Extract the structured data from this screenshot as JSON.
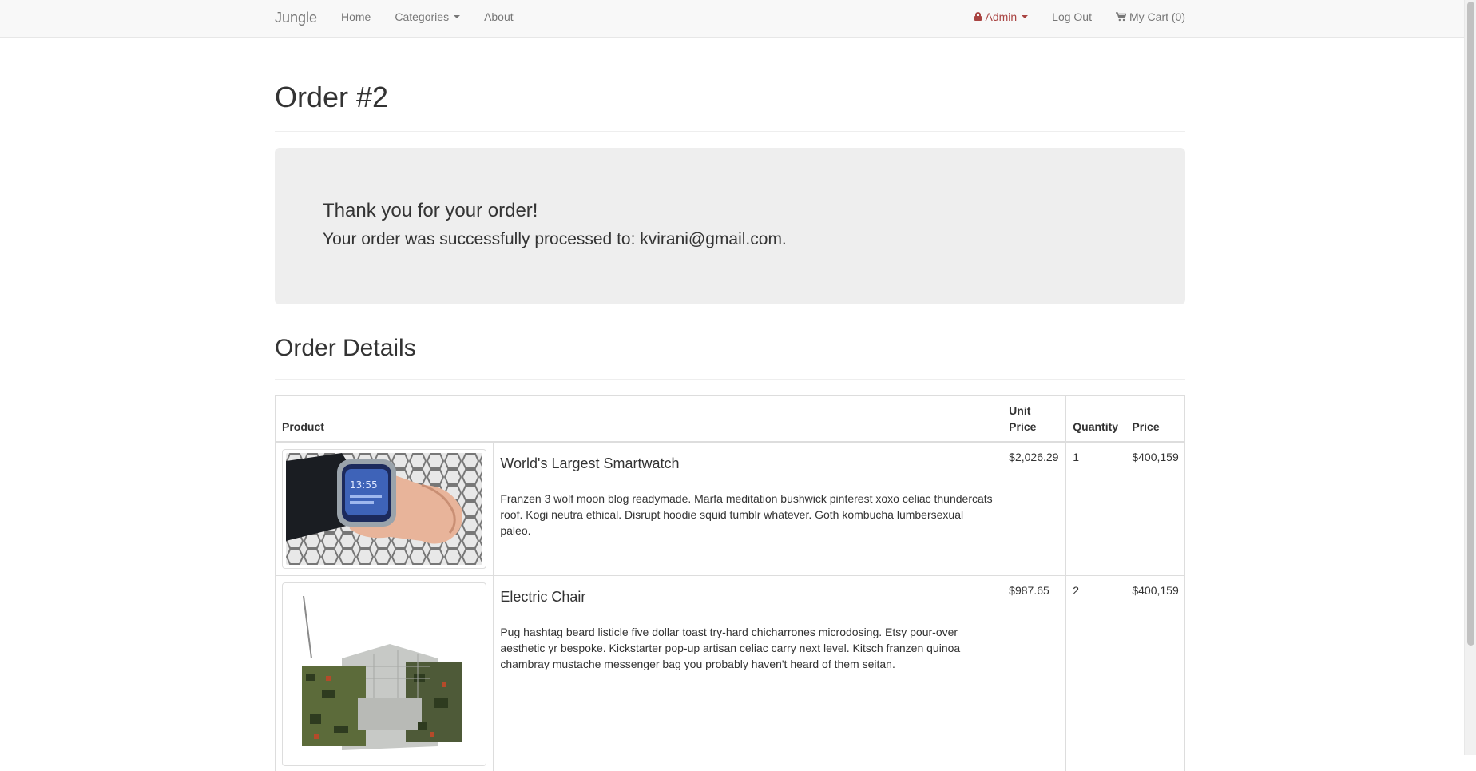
{
  "navbar": {
    "brand": "Jungle",
    "left_links": [
      "Home",
      "Categories",
      "About"
    ],
    "admin_label": "Admin",
    "logout_label": "Log Out",
    "cart_label": "My Cart (0)"
  },
  "page": {
    "title": "Order #2"
  },
  "jumbotron": {
    "thanks": "Thank you for your order!",
    "processed": "Your order was successfully processed to: kvirani@gmail.com."
  },
  "details": {
    "title": "Order Details",
    "headers": {
      "product": "Product",
      "unit_price": "Unit Price",
      "quantity": "Quantity",
      "price": "Price"
    },
    "items": [
      {
        "name": "World's Largest Smartwatch",
        "description": "Franzen 3 wolf moon blog readymade. Marfa meditation bushwick pinterest xoxo celiac thundercats roof. Kogi neutra ethical. Disrupt hoodie squid tumblr whatever. Goth kombucha lumbersexual paleo.",
        "unit_price": "$2,026.29",
        "quantity": "1",
        "price": "$400,159"
      },
      {
        "name": "Electric Chair",
        "description": "Pug hashtag beard listicle five dollar toast try-hard chicharrones microdosing. Etsy pour-over aesthetic yr bespoke. Kickstarter pop-up artisan celiac carry next level. Kitsch franzen quinoa chambray mustache messenger bag you probably haven't heard of them seitan.",
        "unit_price": "$987.65",
        "quantity": "2",
        "price": "$400,159"
      }
    ]
  },
  "colors": {
    "navbar_bg": "#f8f8f8",
    "nav_text": "#777777",
    "admin_text": "#a94442",
    "jumbotron_bg": "#eeeeee"
  }
}
